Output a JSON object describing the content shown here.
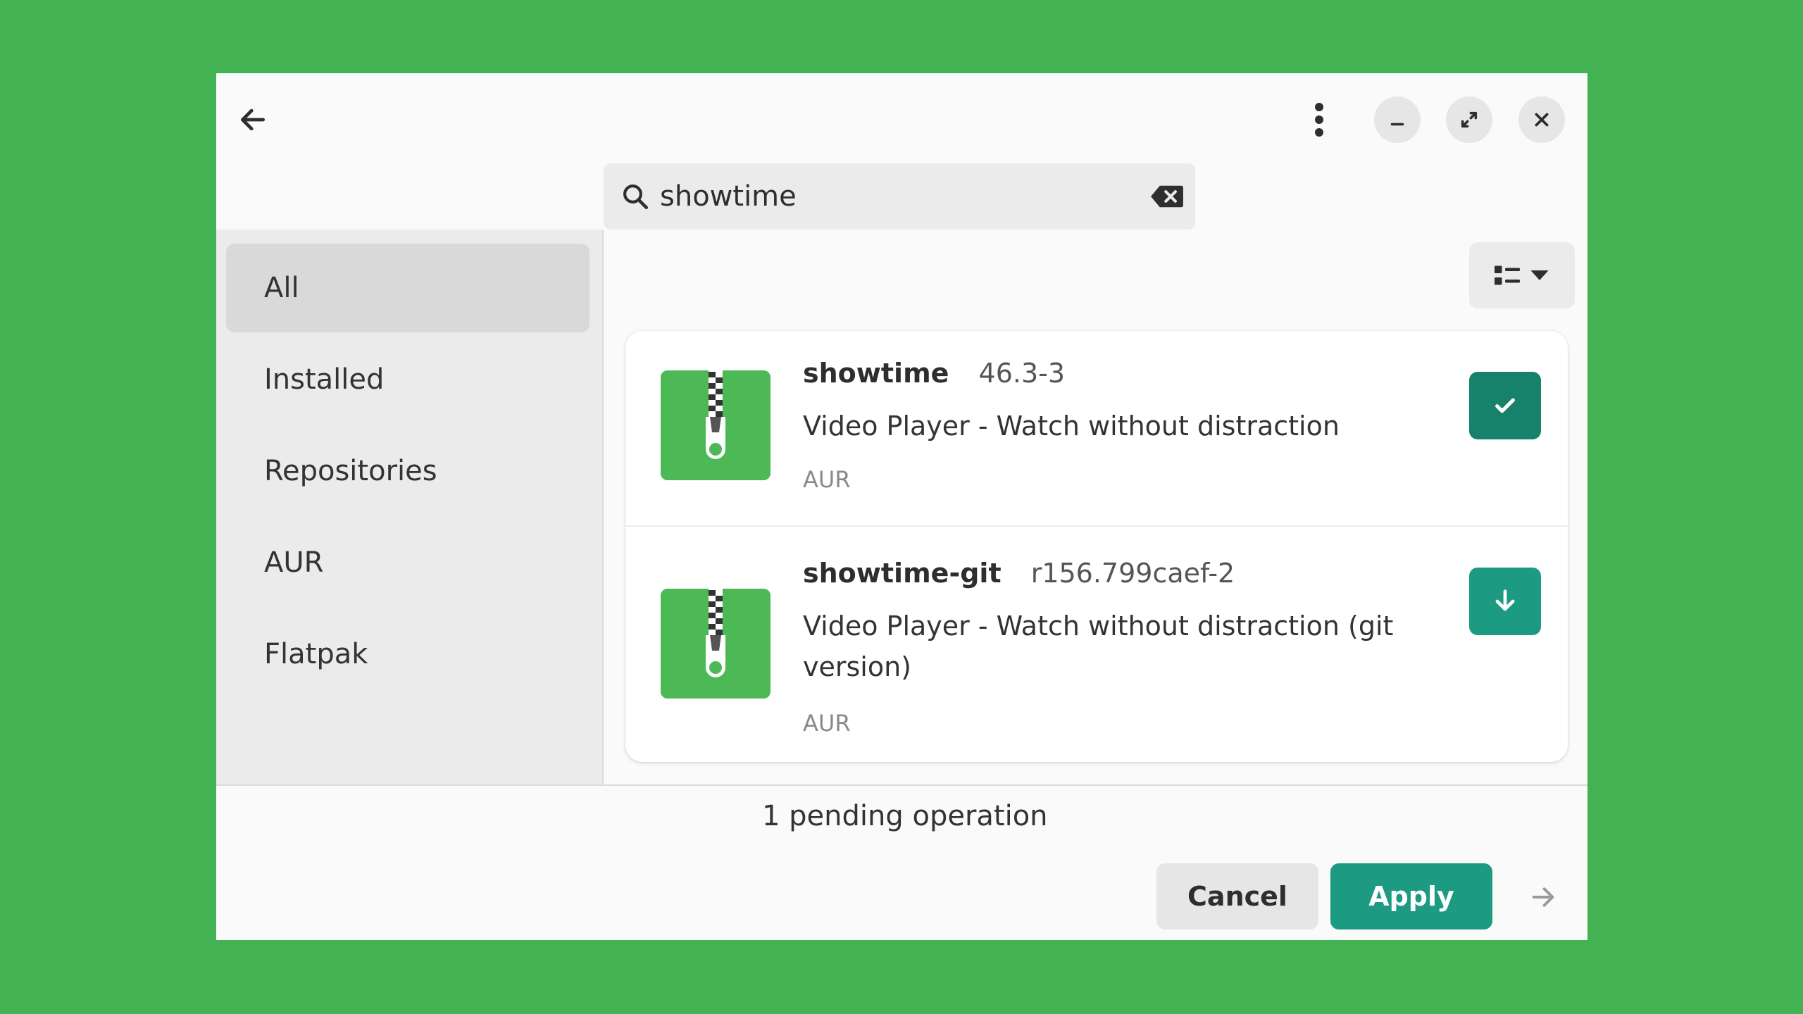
{
  "colors": {
    "desktop": "#42b252",
    "accent": "#1c9b82",
    "accent_dark": "#16826b",
    "package_icon": "#4db856"
  },
  "header": {
    "back_icon": "arrow-left-icon",
    "menu_icon": "kebab-menu-icon",
    "window_controls": [
      "minimize-icon",
      "maximize-icon",
      "close-icon"
    ]
  },
  "search": {
    "value": "showtime",
    "placeholder": "",
    "icon": "search-icon",
    "clear_icon": "backspace-clear-icon"
  },
  "sidebar": {
    "items": [
      {
        "label": "All",
        "active": true
      },
      {
        "label": "Installed",
        "active": false
      },
      {
        "label": "Repositories",
        "active": false
      },
      {
        "label": "AUR",
        "active": false
      },
      {
        "label": "Flatpak",
        "active": false
      }
    ]
  },
  "view_toggle": {
    "icon": "list-view-icon",
    "dropdown_icon": "chevron-down-icon"
  },
  "packages": [
    {
      "name": "showtime",
      "version": "46.3-3",
      "description": "Video Player - Watch without distraction",
      "source": "AUR",
      "action_icon": "check-icon",
      "state": "selected"
    },
    {
      "name": "showtime-git",
      "version": "r156.799caef-2",
      "description": "Video Player - Watch without distraction (git version)",
      "source": "AUR",
      "action_icon": "download-icon",
      "state": "available"
    }
  ],
  "footer": {
    "pending_text": "1 pending operation",
    "cancel_label": "Cancel",
    "apply_label": "Apply",
    "next_icon": "arrow-right-icon"
  }
}
